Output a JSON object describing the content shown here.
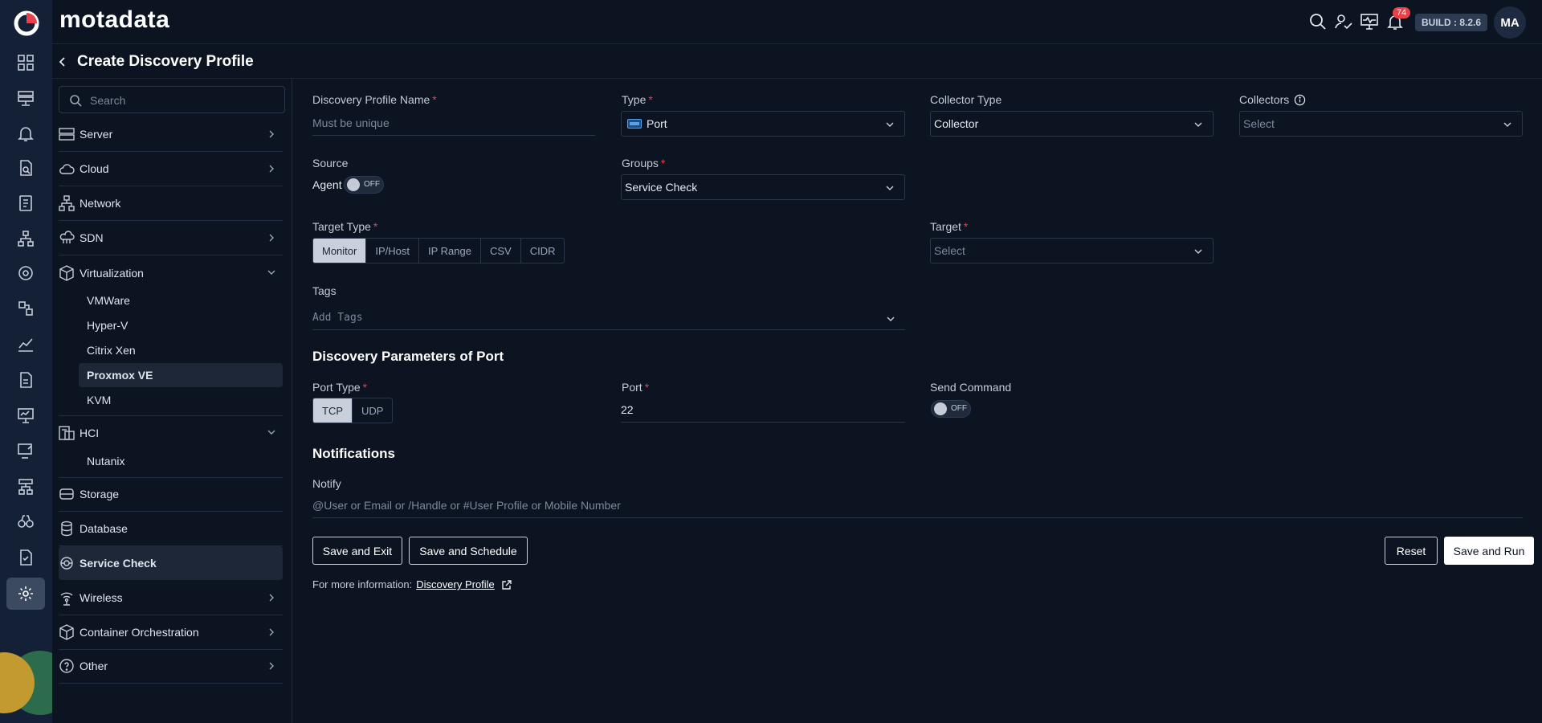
{
  "brand": "motadata",
  "page_title": "Create Discovery Profile",
  "header": {
    "notification_count": "74",
    "build": "BUILD : 8.2.6",
    "avatar_initials": "MA"
  },
  "sidebar": {
    "search_placeholder": "Search",
    "categories": {
      "server": "Server",
      "cloud": "Cloud",
      "network": "Network",
      "sdn": "SDN",
      "virtualization": "Virtualization",
      "hci": "HCI",
      "storage": "Storage",
      "database": "Database",
      "service_check": "Service Check",
      "wireless": "Wireless",
      "container": "Container Orchestration",
      "other": "Other"
    },
    "virtualization_items": [
      "VMWare",
      "Hyper-V",
      "Citrix Xen",
      "Proxmox VE",
      "KVM"
    ],
    "hci_items": [
      "Nutanix"
    ]
  },
  "form": {
    "profile_name_label": "Discovery Profile Name",
    "profile_name_placeholder": "Must be unique",
    "type_label": "Type",
    "type_value": "Port",
    "collector_type_label": "Collector Type",
    "collector_type_value": "Collector",
    "collectors_label": "Collectors",
    "collectors_placeholder": "Select",
    "source_label": "Source",
    "agent_label": "Agent",
    "toggle_off": "OFF",
    "groups_label": "Groups",
    "groups_value": "Service Check",
    "target_type_label": "Target Type",
    "target_types": [
      "Monitor",
      "IP/Host",
      "IP Range",
      "CSV",
      "CIDR"
    ],
    "target_label": "Target",
    "target_placeholder": "Select",
    "tags_label": "Tags",
    "tags_placeholder": "Add Tags",
    "params_title": "Discovery Parameters of Port",
    "port_type_label": "Port Type",
    "port_types": [
      "TCP",
      "UDP"
    ],
    "port_label": "Port",
    "port_value": "22",
    "send_command_label": "Send Command",
    "notifications_title": "Notifications",
    "notify_label": "Notify",
    "notify_placeholder": "@User or Email or /Handle or #User Profile or Mobile Number"
  },
  "actions": {
    "save_exit": "Save and Exit",
    "save_schedule": "Save and Schedule",
    "reset": "Reset",
    "save_run": "Save and Run"
  },
  "footer": {
    "more_info": "For more information:",
    "link": "Discovery Profile"
  }
}
